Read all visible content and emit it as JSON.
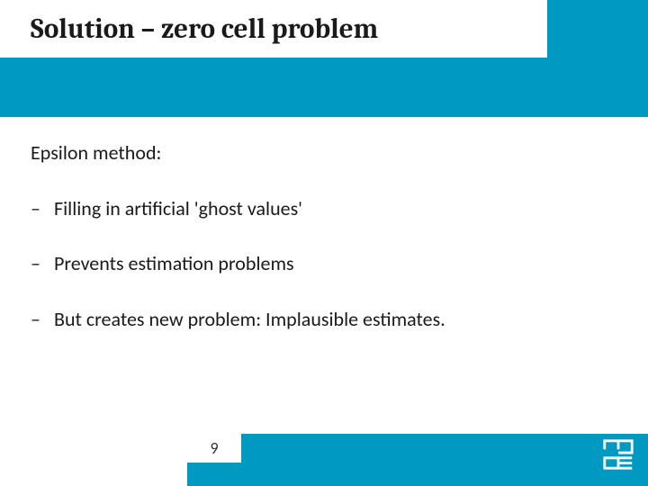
{
  "colors": {
    "accent": "#0099c2",
    "text": "#1a1a1a",
    "bg": "#ffffff"
  },
  "title": "Solution – zero cell problem",
  "intro": "Epsilon method:",
  "bullets": [
    "Filling in artificial  'ghost values'",
    "Prevents estimation problems",
    "But creates new problem: Implausible estimates."
  ],
  "page_number": "9",
  "logo_name": "cbs-logo"
}
